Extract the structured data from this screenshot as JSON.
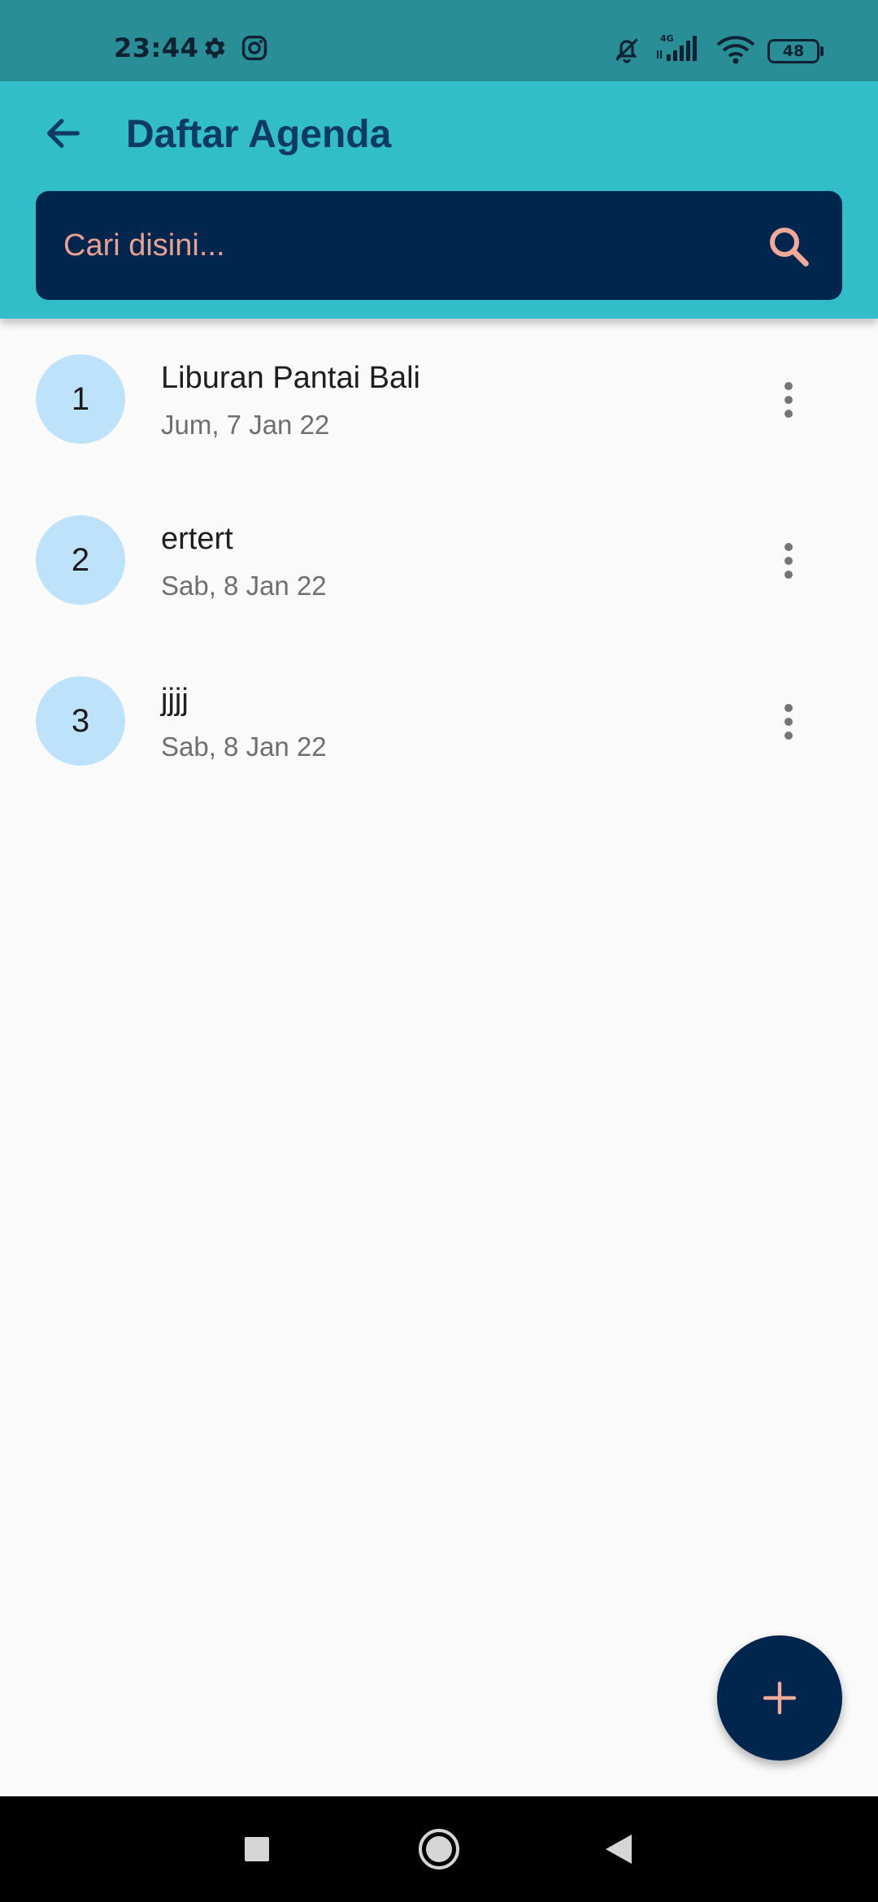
{
  "status_bar": {
    "time": "23:44",
    "network_label": "4G",
    "battery_level": "48"
  },
  "app_bar": {
    "title": "Daftar Agenda"
  },
  "search": {
    "placeholder": "Cari disini..."
  },
  "agenda": {
    "items": [
      {
        "number": "1",
        "title": "Liburan Pantai Bali",
        "date": "Jum, 7 Jan 22"
      },
      {
        "number": "2",
        "title": "ertert",
        "date": "Sab, 8 Jan 22"
      },
      {
        "number": "3",
        "title": "jjjj",
        "date": "Sab, 8 Jan 22"
      }
    ]
  },
  "icons": {
    "back": "arrow-left-icon",
    "search": "search-icon",
    "more": "more-vert-icon",
    "add": "plus-icon",
    "settings": "gear-icon",
    "instagram": "instagram-icon",
    "silent": "bell-off-icon",
    "signal": "signal-icon",
    "wifi": "wifi-icon",
    "nav_recents": "square-icon",
    "nav_home": "circle-icon",
    "nav_back": "triangle-back-icon"
  },
  "colors": {
    "status_bar": "#2a8e96",
    "app_bar": "#31bec8",
    "title": "#0f3a64",
    "search_bg": "#00264d",
    "accent": "#f2a99a",
    "avatar_bg": "#bfe2fb",
    "fab_bg": "#00264d"
  }
}
